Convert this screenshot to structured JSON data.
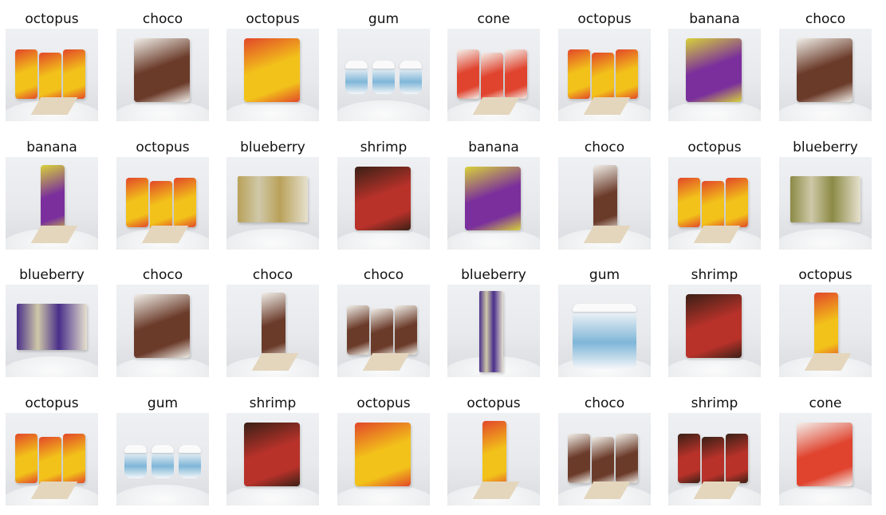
{
  "labels": [
    "octopus",
    "choco",
    "octopus",
    "gum",
    "cone",
    "octopus",
    "banana",
    "choco",
    "banana",
    "octopus",
    "blueberry",
    "shrimp",
    "banana",
    "choco",
    "octopus",
    "blueberry",
    "blueberry",
    "choco",
    "choco",
    "choco",
    "blueberry",
    "gum",
    "shrimp",
    "octopus",
    "octopus",
    "gum",
    "shrimp",
    "octopus",
    "octopus",
    "choco",
    "shrimp",
    "cone"
  ],
  "product_colors": {
    "octopus": "#f2c21a",
    "choco": "#6b3b2a",
    "gum": "#7fb6d8",
    "cone": "#e0432e",
    "banana": "#7a2f9c",
    "blueberry": "#4a2f8a",
    "shrimp": "#b8322a"
  },
  "icons": {
    "photo": "product-photo-icon"
  }
}
